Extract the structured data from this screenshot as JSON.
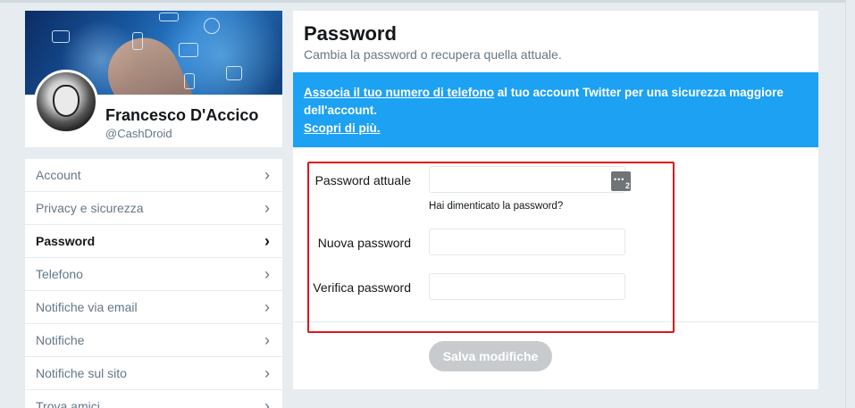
{
  "profile": {
    "name": "Francesco D'Accico",
    "handle": "@CashDroid"
  },
  "nav": {
    "items": [
      {
        "label": "Account",
        "active": false
      },
      {
        "label": "Privacy e sicurezza",
        "active": false
      },
      {
        "label": "Password",
        "active": true
      },
      {
        "label": "Telefono",
        "active": false
      },
      {
        "label": "Notifiche via email",
        "active": false
      },
      {
        "label": "Notifiche",
        "active": false
      },
      {
        "label": "Notifiche sul sito",
        "active": false
      },
      {
        "label": "Trova amici",
        "active": false
      }
    ],
    "chevron": "›"
  },
  "main": {
    "title": "Password",
    "subtitle": "Cambia la password o recupera quella attuale.",
    "banner": {
      "link1": "Associa il tuo numero di telefono",
      "text1": " al tuo account Twitter per una sicurezza maggiore dell'account.",
      "link2": "Scopri di più."
    },
    "fields": {
      "current_label": "Password attuale",
      "current_value": "",
      "forgot": "Hai dimenticato la password?",
      "new_label": "Nuova password",
      "new_value": "",
      "verify_label": "Verifica password",
      "verify_value": "",
      "pm_badge_count": "2"
    },
    "save_label": "Salva modifiche"
  },
  "colors": {
    "accent": "#1da1f2",
    "highlight_box": "#e0141c",
    "button_disabled": "#c8cbce"
  }
}
